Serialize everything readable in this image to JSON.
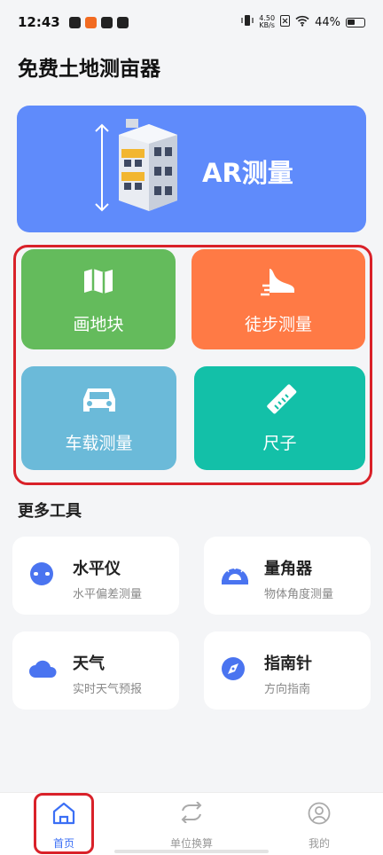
{
  "status_bar": {
    "time": "12:43",
    "net_speed_value": "4.50",
    "net_speed_unit": "KB/s",
    "battery": "44%"
  },
  "app": {
    "title": "免费土地测亩器"
  },
  "ar_banner": {
    "label": "AR测量"
  },
  "tools": [
    {
      "label": "画地块",
      "icon": "map-icon",
      "color": "#64bb5c"
    },
    {
      "label": "徒步测量",
      "icon": "shoe-icon",
      "color": "#ff7a45"
    },
    {
      "label": "车载测量",
      "icon": "car-icon",
      "color": "#6bbad9"
    },
    {
      "label": "尺子",
      "icon": "ruler-icon",
      "color": "#13c0a8"
    }
  ],
  "more_tools": {
    "title": "更多工具",
    "items": [
      {
        "title": "水平仪",
        "subtitle": "水平偏差测量",
        "icon": "level-icon"
      },
      {
        "title": "量角器",
        "subtitle": "物体角度测量",
        "icon": "protractor-icon"
      },
      {
        "title": "天气",
        "subtitle": "实时天气预报",
        "icon": "cloud-icon"
      },
      {
        "title": "指南针",
        "subtitle": "方向指南",
        "icon": "compass-icon"
      }
    ]
  },
  "bottom_nav": [
    {
      "label": "首页",
      "icon": "home-icon",
      "active": true
    },
    {
      "label": "单位换算",
      "icon": "convert-icon",
      "active": false
    },
    {
      "label": "我的",
      "icon": "user-icon",
      "active": false
    }
  ],
  "colors": {
    "accent": "#3b6ff5",
    "banner": "#5f8bfb",
    "highlight": "#d92129"
  }
}
